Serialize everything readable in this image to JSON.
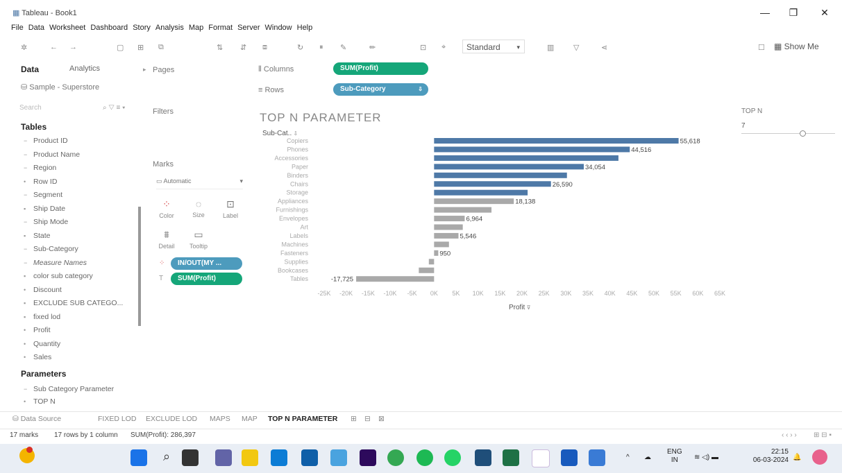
{
  "window": {
    "title": "Tableau - Book1",
    "minimize": "—",
    "maximize": "❐",
    "close": "✕"
  },
  "menu": [
    "File",
    "Data",
    "Worksheet",
    "Dashboard",
    "Story",
    "Analysis",
    "Map",
    "Format",
    "Server",
    "Window",
    "Help"
  ],
  "toolbar": {
    "fit": "Standard",
    "show_me": "Show Me"
  },
  "data_pane": {
    "tab_data": "Data",
    "tab_analytics": "Analytics",
    "datasource": "Sample - Superstore",
    "search_placeholder": "Search",
    "tables_heading": "Tables",
    "fields": [
      "Product ID",
      "Product Name",
      "Region",
      "Row ID",
      "Segment",
      "Ship Date",
      "Ship Mode",
      "State",
      "Sub-Category",
      "Measure Names",
      "color sub category",
      "Discount",
      "EXCLUDE SUB CATEGO...",
      "fixed lod",
      "Profit",
      "Quantity",
      "Sales"
    ],
    "parameters_heading": "Parameters",
    "parameters": [
      "Sub Category Parameter",
      "TOP N"
    ]
  },
  "cards": {
    "pages": "Pages",
    "filters": "Filters",
    "marks": "Marks",
    "marks_type": "Automatic",
    "mark_buttons": [
      "Color",
      "Size",
      "Label",
      "Detail",
      "Tooltip"
    ],
    "mark_pills": [
      "IN/OUT(MY ...",
      "SUM(Profit)"
    ]
  },
  "shelves": {
    "columns_label": "Columns",
    "columns_pill": "SUM(Profit)",
    "rows_label": "Rows",
    "rows_pill": "Sub-Category"
  },
  "topn": {
    "label": "TOP N",
    "value": "7"
  },
  "chart_data": {
    "type": "bar",
    "title": "TOP N PARAMETER",
    "row_header": "Sub-Cat..",
    "xlabel": "Profit",
    "categories": [
      "Copiers",
      "Phones",
      "Accessories",
      "Paper",
      "Binders",
      "Chairs",
      "Storage",
      "Appliances",
      "Furnishings",
      "Envelopes",
      "Art",
      "Labels",
      "Machines",
      "Fasteners",
      "Supplies",
      "Bookcases",
      "Tables"
    ],
    "values": [
      55618,
      44516,
      41937,
      34054,
      30222,
      26590,
      21279,
      18138,
      13059,
      6964,
      6528,
      5546,
      3385,
      950,
      -1189,
      -3473,
      -17725
    ],
    "in_top_n": [
      true,
      true,
      true,
      true,
      true,
      true,
      true,
      false,
      false,
      false,
      false,
      false,
      false,
      false,
      false,
      false,
      false
    ],
    "data_labels": {
      "Copiers": "55,618",
      "Phones": "44,516",
      "Paper": "34,054",
      "Chairs": "26,590",
      "Appliances": "18,138",
      "Envelopes": "6,964",
      "Labels": "5,546",
      "Fasteners": "950",
      "Tables": "-17,725"
    },
    "ticks": [
      -25000,
      -20000,
      -15000,
      -10000,
      -5000,
      0,
      5000,
      10000,
      15000,
      20000,
      25000,
      30000,
      35000,
      40000,
      45000,
      50000,
      55000,
      60000,
      65000
    ],
    "tick_labels": [
      "-25K",
      "-20K",
      "-15K",
      "-10K",
      "-5K",
      "0K",
      "5K",
      "10K",
      "15K",
      "20K",
      "25K",
      "30K",
      "35K",
      "40K",
      "45K",
      "50K",
      "55K",
      "60K",
      "65K"
    ],
    "xlim": [
      -25000,
      65000
    ],
    "colors": {
      "in": "#4e79a7",
      "out": "#a9a9a9"
    }
  },
  "tabs": [
    "Data Source",
    "FIXED LOD",
    "EXCLUDE LOD",
    "MAPS",
    "MAP",
    "TOP N PARAMETER"
  ],
  "status": {
    "marks": "17 marks",
    "rows": "17 rows by 1 column",
    "sum": "SUM(Profit): 286,397"
  },
  "tray": {
    "lang": "ENG",
    "region": "IN",
    "time": "22:15",
    "date": "06-03-2024"
  }
}
